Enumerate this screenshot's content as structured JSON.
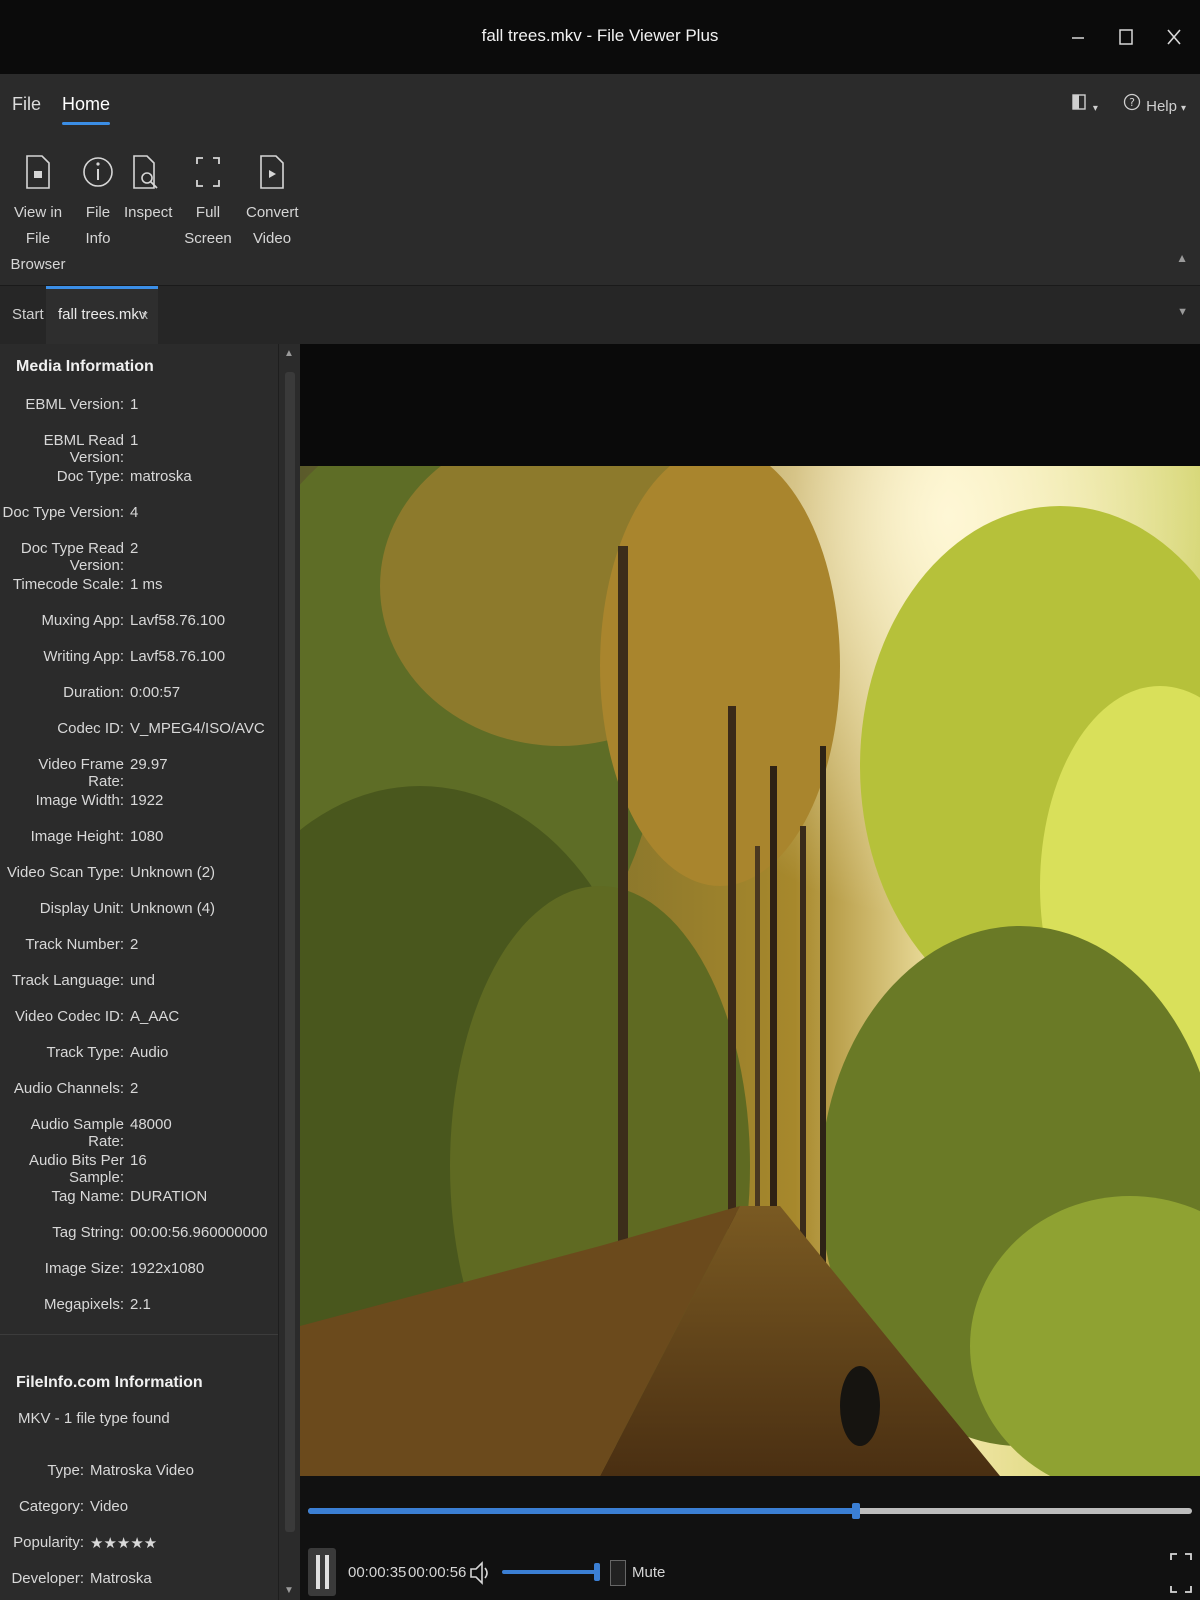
{
  "window": {
    "title": "fall trees.mkv - File Viewer Plus",
    "controls": [
      "minimize-icon",
      "maximize-icon",
      "close-icon"
    ]
  },
  "menu": {
    "file_label": "File",
    "home_label": "Home",
    "help_label": "Help"
  },
  "ribbon": {
    "view_in_file_browser": {
      "line1": "View in File",
      "line2": "Browser",
      "icon": "folder-icon"
    },
    "file_info": {
      "label": "File Info",
      "icon": "info-icon"
    },
    "inspect": {
      "label": "Inspect",
      "icon": "inspect-icon"
    },
    "full_screen": {
      "label": "Full Screen",
      "icon": "fullscreen-icon"
    },
    "convert_video": {
      "line1": "Convert",
      "line2": "Video",
      "icon": "convert-icon"
    }
  },
  "doc_tabs": {
    "start_label": "Start",
    "active_label": "fall trees.mkv",
    "close_glyph": "x"
  },
  "media_info": {
    "title": "Media Information",
    "rows": [
      {
        "key": "EBML Version:",
        "value": "1"
      },
      {
        "key": "EBML Read Version:",
        "value": "1"
      },
      {
        "key": "Doc Type:",
        "value": "matroska"
      },
      {
        "key": "Doc Type Version:",
        "value": "4"
      },
      {
        "key": "Doc Type Read Version:",
        "value": "2"
      },
      {
        "key": "Timecode Scale:",
        "value": "1 ms"
      },
      {
        "key": "Muxing App:",
        "value": "Lavf58.76.100"
      },
      {
        "key": "Writing App:",
        "value": "Lavf58.76.100"
      },
      {
        "key": "Duration:",
        "value": "0:00:57"
      },
      {
        "key": "Codec ID:",
        "value": "V_MPEG4/ISO/AVC"
      },
      {
        "key": "Video Frame Rate:",
        "value": "29.97"
      },
      {
        "key": "Image Width:",
        "value": "1922"
      },
      {
        "key": "Image Height:",
        "value": "1080"
      },
      {
        "key": "Video Scan Type:",
        "value": "Unknown (2)"
      },
      {
        "key": "Display Unit:",
        "value": "Unknown (4)"
      },
      {
        "key": "Track Number:",
        "value": "2"
      },
      {
        "key": "Track Language:",
        "value": "und"
      },
      {
        "key": "Video Codec ID:",
        "value": "A_AAC"
      },
      {
        "key": "Track Type:",
        "value": "Audio"
      },
      {
        "key": "Audio Channels:",
        "value": "2"
      },
      {
        "key": "Audio Sample Rate:",
        "value": "48000"
      },
      {
        "key": "Audio Bits Per Sample:",
        "value": "16"
      },
      {
        "key": "Tag Name:",
        "value": "DURATION"
      },
      {
        "key": "Tag String:",
        "value": "00:00:56.960000000"
      },
      {
        "key": "Image Size:",
        "value": "1922x1080"
      },
      {
        "key": "Megapixels:",
        "value": "2.1"
      }
    ]
  },
  "fileinfo": {
    "title": "FileInfo.com Information",
    "found": "MKV - 1 file type found",
    "rows": [
      {
        "key": "Type:",
        "value": "Matroska Video"
      },
      {
        "key": "Category:",
        "value": "Video"
      },
      {
        "key": "Popularity:",
        "value": "★★★★★"
      },
      {
        "key": "Developer:",
        "value": "Matroska"
      }
    ]
  },
  "player": {
    "current_time": "00:00:35",
    "total_time": "00:00:56",
    "progress": 0.62,
    "volume": 1.0,
    "mute_label": "Mute",
    "mute_checked": false
  },
  "colors": {
    "accent": "#3b8ee6",
    "seek_fill": "#3b7fd4",
    "background": "#1f1f1f",
    "panel": "#2b2b2b"
  }
}
